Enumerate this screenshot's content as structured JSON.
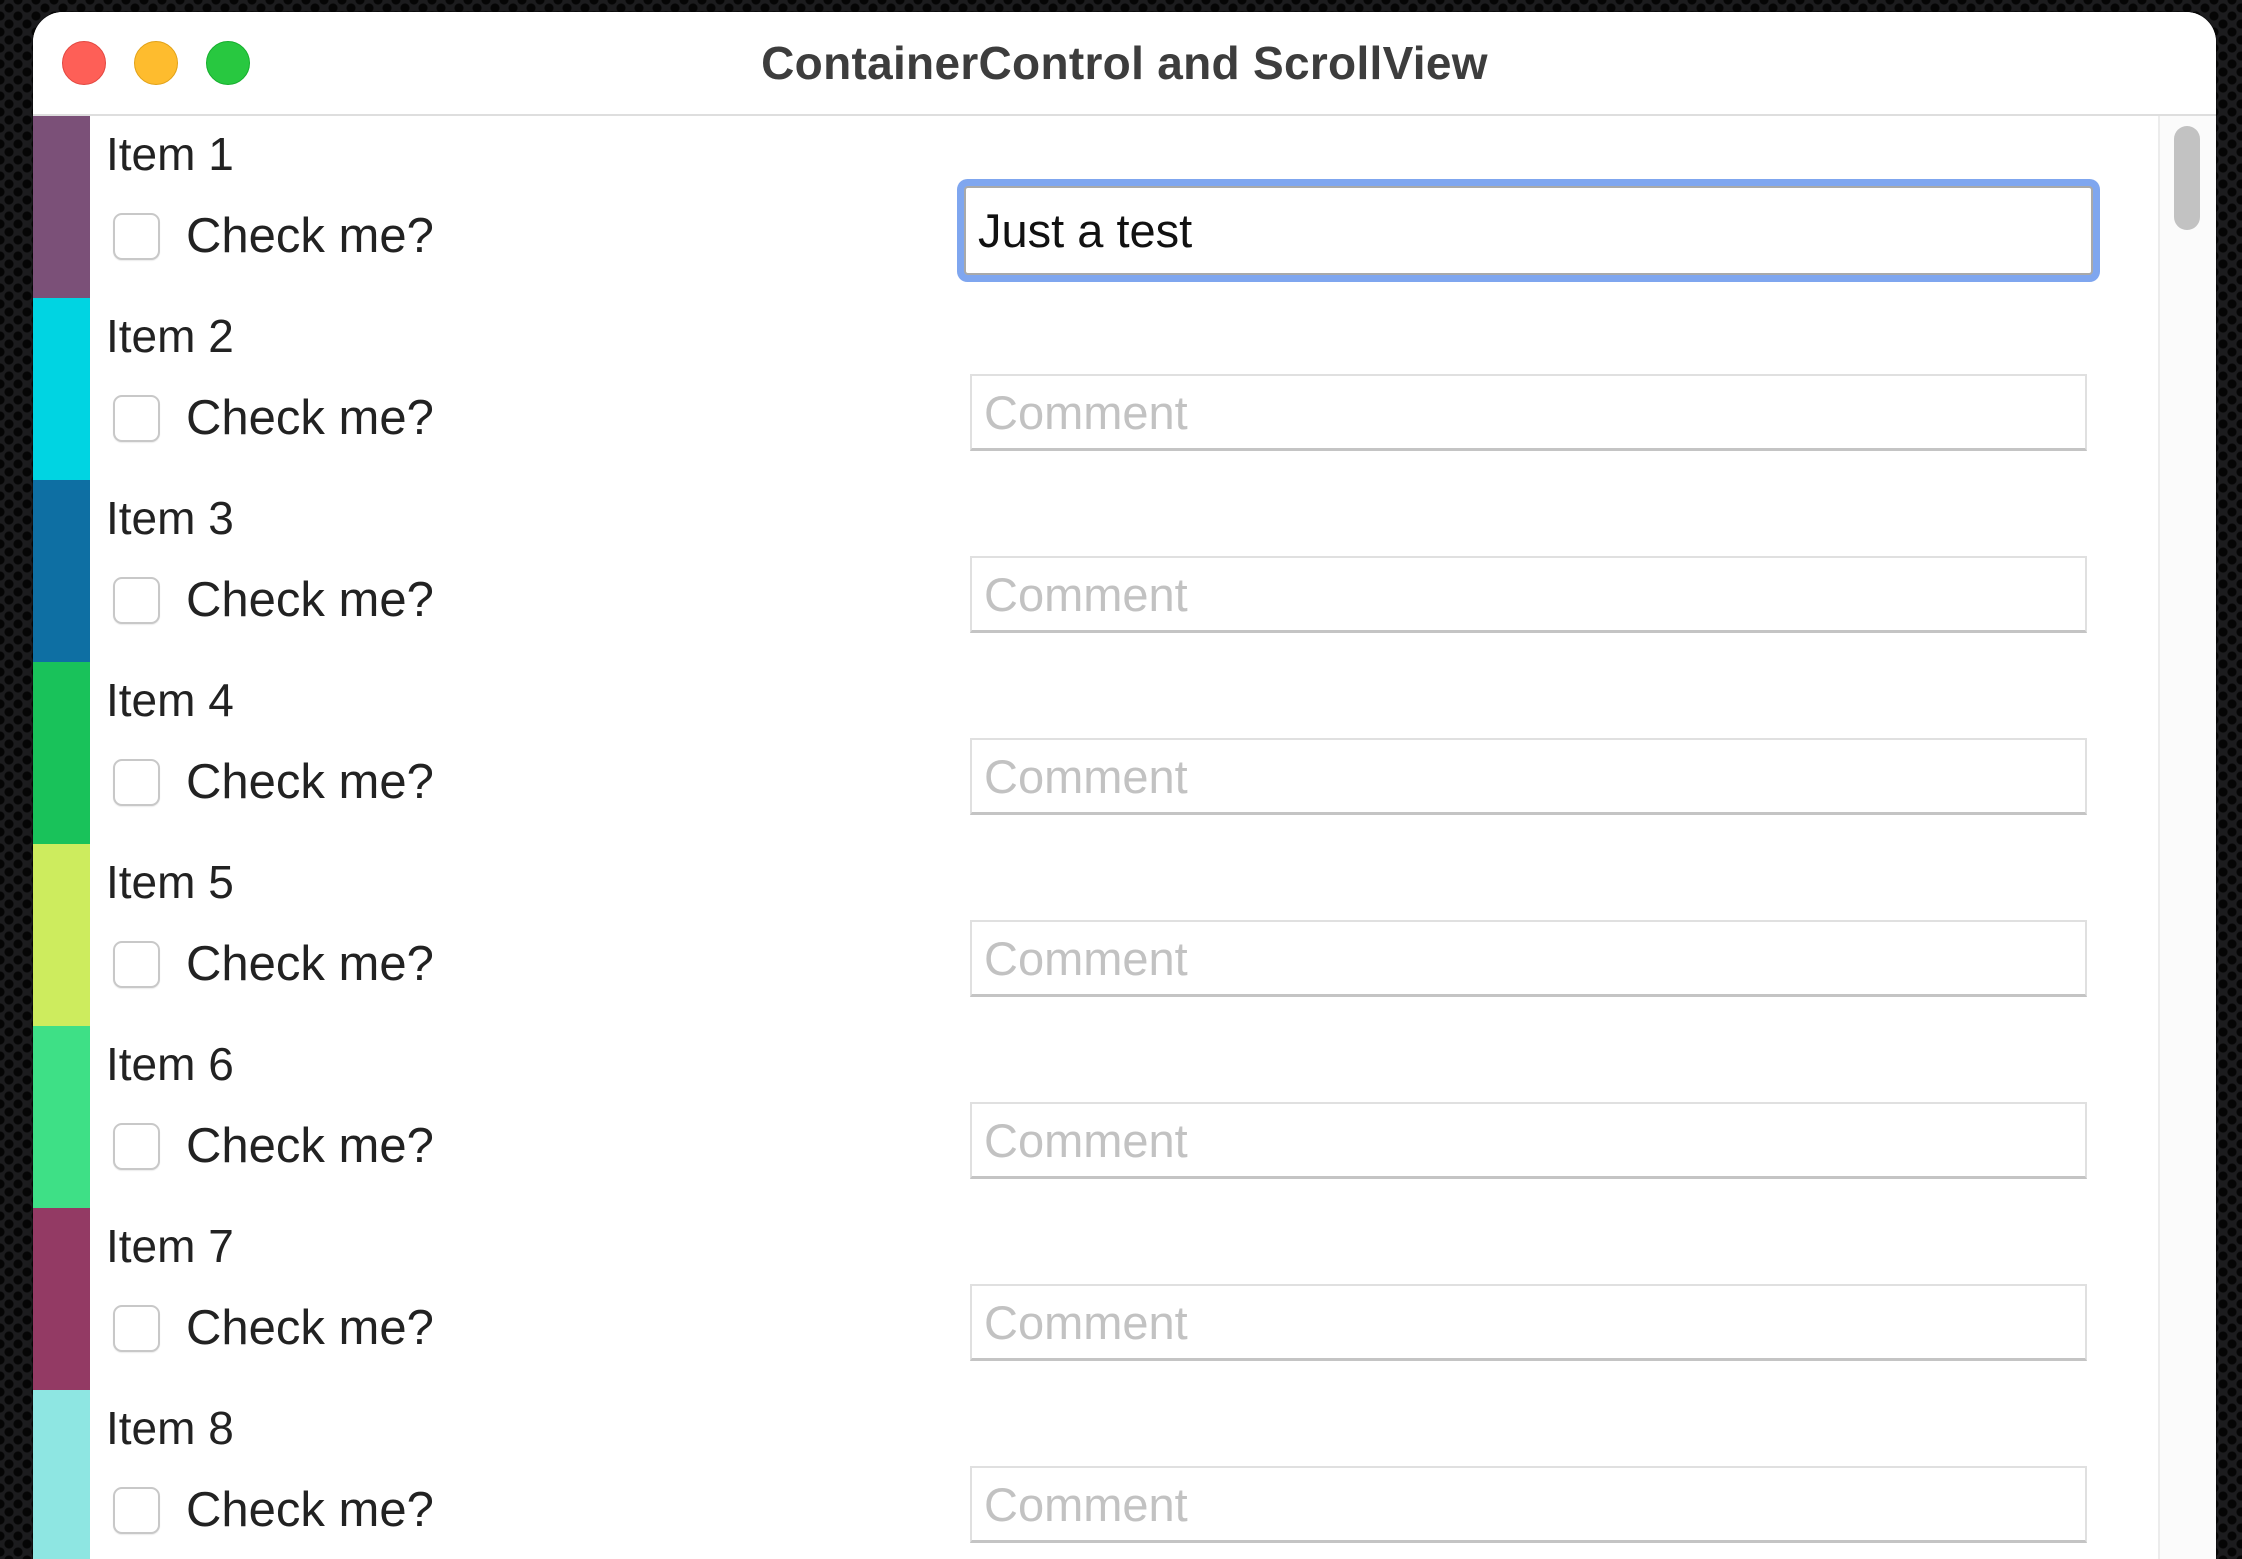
{
  "window": {
    "title": "ContainerControl and ScrollView"
  },
  "items": [
    {
      "label": "Item 1",
      "check_label": "Check me?",
      "checked": false,
      "comment_value": "Just a test",
      "comment_placeholder": "Comment",
      "focused": true,
      "color": "#7b5078"
    },
    {
      "label": "Item 2",
      "check_label": "Check me?",
      "checked": false,
      "comment_value": "",
      "comment_placeholder": "Comment",
      "focused": false,
      "color": "#00d4e2"
    },
    {
      "label": "Item 3",
      "check_label": "Check me?",
      "checked": false,
      "comment_value": "",
      "comment_placeholder": "Comment",
      "focused": false,
      "color": "#0e6fa3"
    },
    {
      "label": "Item 4",
      "check_label": "Check me?",
      "checked": false,
      "comment_value": "",
      "comment_placeholder": "Comment",
      "focused": false,
      "color": "#19c25a"
    },
    {
      "label": "Item 5",
      "check_label": "Check me?",
      "checked": false,
      "comment_value": "",
      "comment_placeholder": "Comment",
      "focused": false,
      "color": "#cdec5e"
    },
    {
      "label": "Item 6",
      "check_label": "Check me?",
      "checked": false,
      "comment_value": "",
      "comment_placeholder": "Comment",
      "focused": false,
      "color": "#3ee086"
    },
    {
      "label": "Item 7",
      "check_label": "Check me?",
      "checked": false,
      "comment_value": "",
      "comment_placeholder": "Comment",
      "focused": false,
      "color": "#933a64"
    },
    {
      "label": "Item 8",
      "check_label": "Check me?",
      "checked": false,
      "comment_value": "",
      "comment_placeholder": "Comment",
      "focused": false,
      "color": "#8ee6e2"
    }
  ],
  "colors": {
    "close_button": "#fe5f57",
    "minimize_button": "#febc2e",
    "zoom_button": "#28c840",
    "focus_ring": "#7fa6ef"
  }
}
